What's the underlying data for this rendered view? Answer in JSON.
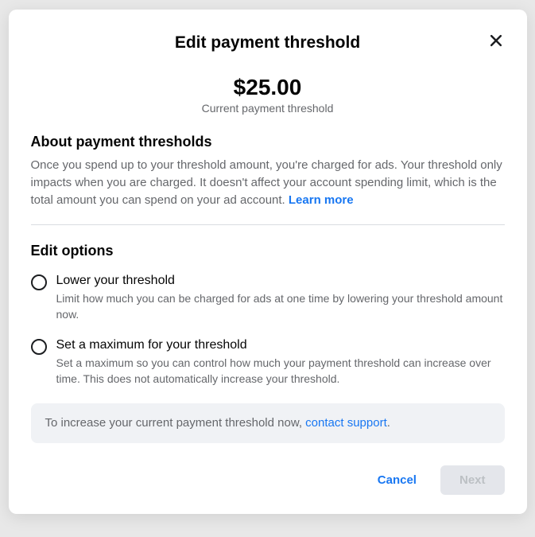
{
  "modal": {
    "title": "Edit payment threshold",
    "amount": "$25.00",
    "amount_label": "Current payment threshold",
    "about": {
      "heading": "About payment thresholds",
      "text": "Once you spend up to your threshold amount, you're charged for ads. Your threshold only impacts when you are charged. It doesn't affect your account spending limit, which is the total amount you can spend on your ad account. ",
      "learn_more": "Learn more"
    },
    "edit_options": {
      "heading": "Edit options",
      "options": [
        {
          "title": "Lower your threshold",
          "desc": "Limit how much you can be charged for ads at one time by lowering your threshold amount now."
        },
        {
          "title": "Set a maximum for your threshold",
          "desc": "Set a maximum so you can control how much your payment threshold can increase over time. This does not automatically increase your threshold."
        }
      ]
    },
    "info_box": {
      "text": "To increase your current payment threshold now, ",
      "link": "contact support",
      "suffix": "."
    },
    "footer": {
      "cancel": "Cancel",
      "next": "Next"
    }
  }
}
